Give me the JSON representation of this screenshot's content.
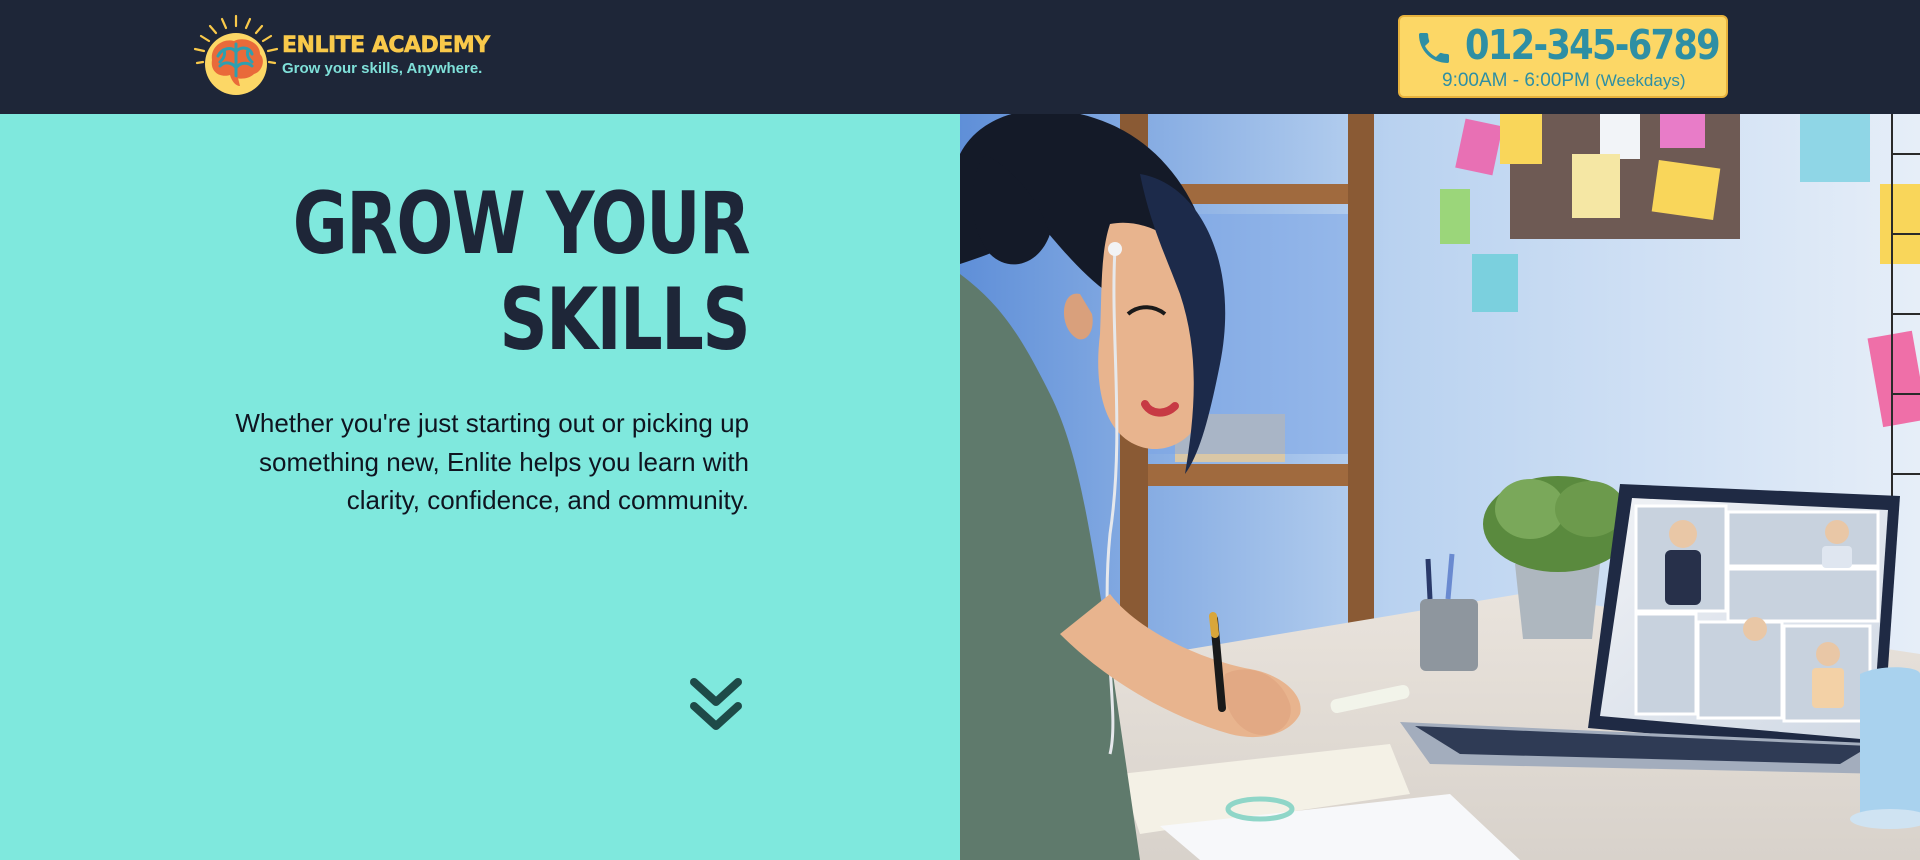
{
  "header": {
    "brand": {
      "name": "ENLITE ACADEMY",
      "tagline": "Grow your skills, Anywhere.",
      "logo_icon": "brain-sun-icon"
    },
    "contact": {
      "phone_icon": "phone-icon",
      "phone": "012-345-6789",
      "hours": "9:00AM - 6:00PM",
      "days": "(Weekdays)"
    }
  },
  "hero": {
    "headline_line1": "GROW YOUR",
    "headline_line2": "SKILLS",
    "subtext": "Whether you're just starting out or picking up something new, Enlite helps you learn with clarity, confidence, and community.",
    "scroll_icon": "double-chevron-down-icon",
    "image_subject": "woman-taking-notes-during-video-call-photo"
  },
  "colors": {
    "header_bg": "#1e2638",
    "accent_yellow": "#fcd766",
    "accent_teal": "#7fe8dd",
    "phone_text": "#2e8fa4",
    "headline": "#1e2638"
  }
}
